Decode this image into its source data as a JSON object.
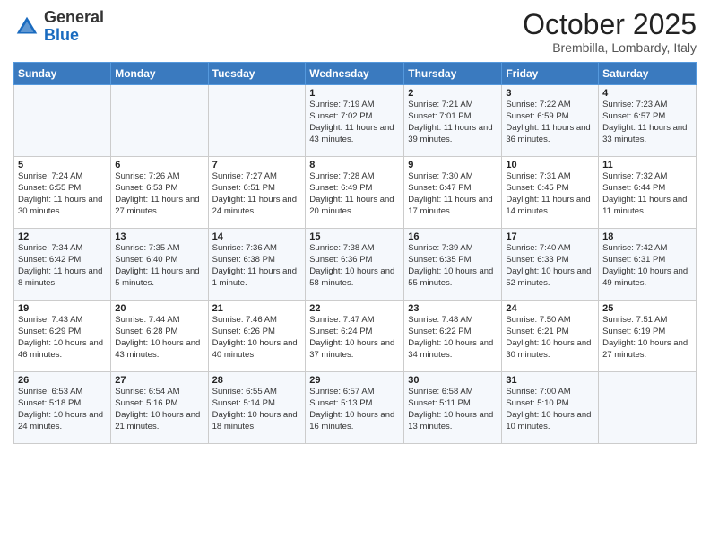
{
  "header": {
    "logo_general": "General",
    "logo_blue": "Blue",
    "month": "October 2025",
    "location": "Brembilla, Lombardy, Italy"
  },
  "days_of_week": [
    "Sunday",
    "Monday",
    "Tuesday",
    "Wednesday",
    "Thursday",
    "Friday",
    "Saturday"
  ],
  "weeks": [
    [
      {
        "day": "",
        "info": ""
      },
      {
        "day": "",
        "info": ""
      },
      {
        "day": "",
        "info": ""
      },
      {
        "day": "1",
        "info": "Sunrise: 7:19 AM\nSunset: 7:02 PM\nDaylight: 11 hours and 43 minutes."
      },
      {
        "day": "2",
        "info": "Sunrise: 7:21 AM\nSunset: 7:01 PM\nDaylight: 11 hours and 39 minutes."
      },
      {
        "day": "3",
        "info": "Sunrise: 7:22 AM\nSunset: 6:59 PM\nDaylight: 11 hours and 36 minutes."
      },
      {
        "day": "4",
        "info": "Sunrise: 7:23 AM\nSunset: 6:57 PM\nDaylight: 11 hours and 33 minutes."
      }
    ],
    [
      {
        "day": "5",
        "info": "Sunrise: 7:24 AM\nSunset: 6:55 PM\nDaylight: 11 hours and 30 minutes."
      },
      {
        "day": "6",
        "info": "Sunrise: 7:26 AM\nSunset: 6:53 PM\nDaylight: 11 hours and 27 minutes."
      },
      {
        "day": "7",
        "info": "Sunrise: 7:27 AM\nSunset: 6:51 PM\nDaylight: 11 hours and 24 minutes."
      },
      {
        "day": "8",
        "info": "Sunrise: 7:28 AM\nSunset: 6:49 PM\nDaylight: 11 hours and 20 minutes."
      },
      {
        "day": "9",
        "info": "Sunrise: 7:30 AM\nSunset: 6:47 PM\nDaylight: 11 hours and 17 minutes."
      },
      {
        "day": "10",
        "info": "Sunrise: 7:31 AM\nSunset: 6:45 PM\nDaylight: 11 hours and 14 minutes."
      },
      {
        "day": "11",
        "info": "Sunrise: 7:32 AM\nSunset: 6:44 PM\nDaylight: 11 hours and 11 minutes."
      }
    ],
    [
      {
        "day": "12",
        "info": "Sunrise: 7:34 AM\nSunset: 6:42 PM\nDaylight: 11 hours and 8 minutes."
      },
      {
        "day": "13",
        "info": "Sunrise: 7:35 AM\nSunset: 6:40 PM\nDaylight: 11 hours and 5 minutes."
      },
      {
        "day": "14",
        "info": "Sunrise: 7:36 AM\nSunset: 6:38 PM\nDaylight: 11 hours and 1 minute."
      },
      {
        "day": "15",
        "info": "Sunrise: 7:38 AM\nSunset: 6:36 PM\nDaylight: 10 hours and 58 minutes."
      },
      {
        "day": "16",
        "info": "Sunrise: 7:39 AM\nSunset: 6:35 PM\nDaylight: 10 hours and 55 minutes."
      },
      {
        "day": "17",
        "info": "Sunrise: 7:40 AM\nSunset: 6:33 PM\nDaylight: 10 hours and 52 minutes."
      },
      {
        "day": "18",
        "info": "Sunrise: 7:42 AM\nSunset: 6:31 PM\nDaylight: 10 hours and 49 minutes."
      }
    ],
    [
      {
        "day": "19",
        "info": "Sunrise: 7:43 AM\nSunset: 6:29 PM\nDaylight: 10 hours and 46 minutes."
      },
      {
        "day": "20",
        "info": "Sunrise: 7:44 AM\nSunset: 6:28 PM\nDaylight: 10 hours and 43 minutes."
      },
      {
        "day": "21",
        "info": "Sunrise: 7:46 AM\nSunset: 6:26 PM\nDaylight: 10 hours and 40 minutes."
      },
      {
        "day": "22",
        "info": "Sunrise: 7:47 AM\nSunset: 6:24 PM\nDaylight: 10 hours and 37 minutes."
      },
      {
        "day": "23",
        "info": "Sunrise: 7:48 AM\nSunset: 6:22 PM\nDaylight: 10 hours and 34 minutes."
      },
      {
        "day": "24",
        "info": "Sunrise: 7:50 AM\nSunset: 6:21 PM\nDaylight: 10 hours and 30 minutes."
      },
      {
        "day": "25",
        "info": "Sunrise: 7:51 AM\nSunset: 6:19 PM\nDaylight: 10 hours and 27 minutes."
      }
    ],
    [
      {
        "day": "26",
        "info": "Sunrise: 6:53 AM\nSunset: 5:18 PM\nDaylight: 10 hours and 24 minutes."
      },
      {
        "day": "27",
        "info": "Sunrise: 6:54 AM\nSunset: 5:16 PM\nDaylight: 10 hours and 21 minutes."
      },
      {
        "day": "28",
        "info": "Sunrise: 6:55 AM\nSunset: 5:14 PM\nDaylight: 10 hours and 18 minutes."
      },
      {
        "day": "29",
        "info": "Sunrise: 6:57 AM\nSunset: 5:13 PM\nDaylight: 10 hours and 16 minutes."
      },
      {
        "day": "30",
        "info": "Sunrise: 6:58 AM\nSunset: 5:11 PM\nDaylight: 10 hours and 13 minutes."
      },
      {
        "day": "31",
        "info": "Sunrise: 7:00 AM\nSunset: 5:10 PM\nDaylight: 10 hours and 10 minutes."
      },
      {
        "day": "",
        "info": ""
      }
    ]
  ]
}
